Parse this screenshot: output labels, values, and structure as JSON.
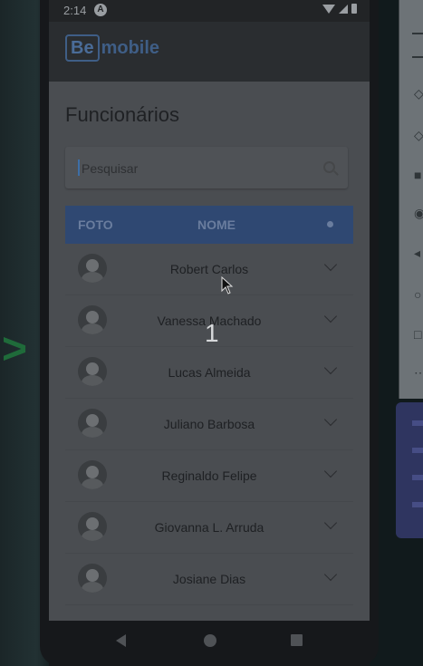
{
  "status_bar": {
    "time": "2:14",
    "notification_badge": "A"
  },
  "header": {
    "logo_be": "Be",
    "logo_mobile": "mobile"
  },
  "page": {
    "title": "Funcionários",
    "search_placeholder": "Pesquisar"
  },
  "table": {
    "col_photo": "FOTO",
    "col_name": "NOME",
    "rows": [
      {
        "name": "Robert Carlos"
      },
      {
        "name": "Vanessa Machado"
      },
      {
        "name": "Lucas Almeida"
      },
      {
        "name": "Juliano Barbosa"
      },
      {
        "name": "Reginaldo Felipe"
      },
      {
        "name": "Giovanna L. Arruda"
      },
      {
        "name": "Josiane Dias"
      }
    ]
  },
  "overlay": {
    "number": "1"
  },
  "colors": {
    "header_blue": "#2f4872",
    "accent": "#3d6ea6"
  }
}
